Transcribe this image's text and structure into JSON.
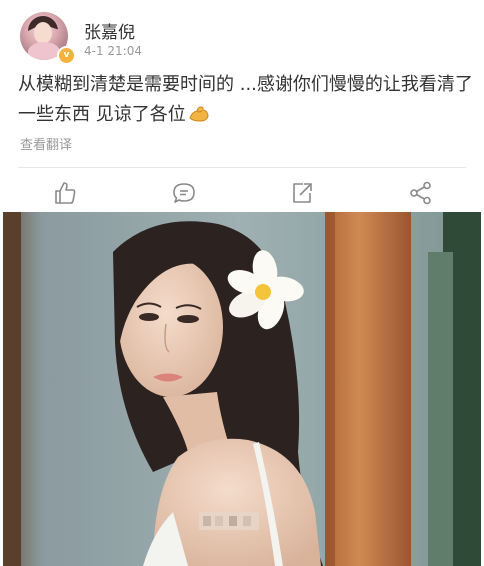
{
  "post": {
    "author": {
      "name": "张嘉倪",
      "avatar_icon": "avatar",
      "badge_icon": "vip-badge-icon",
      "badge_color": "#f6b33b"
    },
    "timestamp": "4-1 21:04",
    "text_before_emoji": "从模糊到清楚是需要时间的 ...感谢你们慢慢的让我看清了一些东西 见谅了各位",
    "emoji_icon": "flexed-biceps-icon",
    "translate_label": "查看翻译",
    "actions": [
      {
        "name": "like",
        "icon": "thumbs-up-icon"
      },
      {
        "name": "comment",
        "icon": "comment-icon"
      },
      {
        "name": "repost",
        "icon": "repost-icon"
      },
      {
        "name": "share",
        "icon": "share-icon"
      }
    ],
    "image": {
      "description_icon": "post-photo",
      "flower_icon": "plumeria-flower-icon"
    }
  },
  "colors": {
    "text_primary": "#333333",
    "text_secondary": "#999999",
    "divider": "#e6e6e6",
    "icon_gray": "#8a8a8a"
  }
}
